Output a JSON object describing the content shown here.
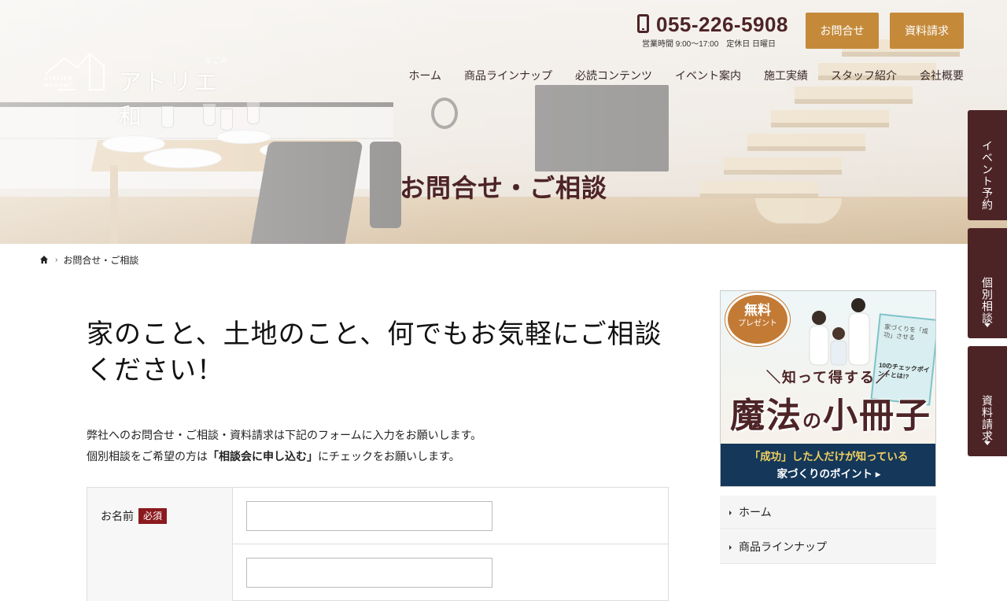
{
  "header": {
    "logo": {
      "brand_jp": "アトリエ和",
      "ruby": "なごみ",
      "brand_en_line1": "ATELIER",
      "brand_en_line2": "NAGOMI"
    },
    "phone": {
      "number": "055-226-5908",
      "hours": "営業時間 9:00～17:00　定休日 日曜日"
    },
    "buttons": {
      "contact": "お問合せ",
      "request": "資料請求"
    },
    "nav": [
      "ホーム",
      "商品ラインナップ",
      "必読コンテンツ",
      "イベント案内",
      "施工実績",
      "スタッフ紹介",
      "会社概要"
    ]
  },
  "hero": {
    "title": "お問合せ・ご相談"
  },
  "side_tabs": [
    "イベント予約",
    "個別相談",
    "資料請求"
  ],
  "breadcrumb": {
    "current": "お問合せ・ご相談"
  },
  "main": {
    "heading": "家のこと、土地のこと、何でもお気軽にご相談ください！",
    "intro_line1": "弊社へのお問合せ・ご相談・資料請求は下記のフォームに入力をお願いします。",
    "intro_line2_pre": "個別相談をご希望の方は",
    "intro_line2_bold": "「相談会に申し込む」",
    "intro_line2_post": "にチェックをお願いします。",
    "form": {
      "name_label": "お名前",
      "required_badge": "必須"
    }
  },
  "sidebar": {
    "banner": {
      "badge_line1": "無料",
      "badge_line2": "プレゼント",
      "subtitle": "＼知って得する／",
      "title_big1": "魔法",
      "title_small": "の",
      "title_big2": "小冊子",
      "bottom_line1": "「成功」した人だけが知っている",
      "bottom_line2": "家づくりのポイント ▸",
      "book_text": "家づくりを「成功」させる",
      "book_points": "10のチェックポイントとは!?"
    },
    "menu": [
      "ホーム",
      "商品ラインナップ"
    ]
  },
  "colors": {
    "brand_brown": "#4d2426",
    "accent_gold": "#c48a3a",
    "required_red": "#8b1a1f"
  }
}
